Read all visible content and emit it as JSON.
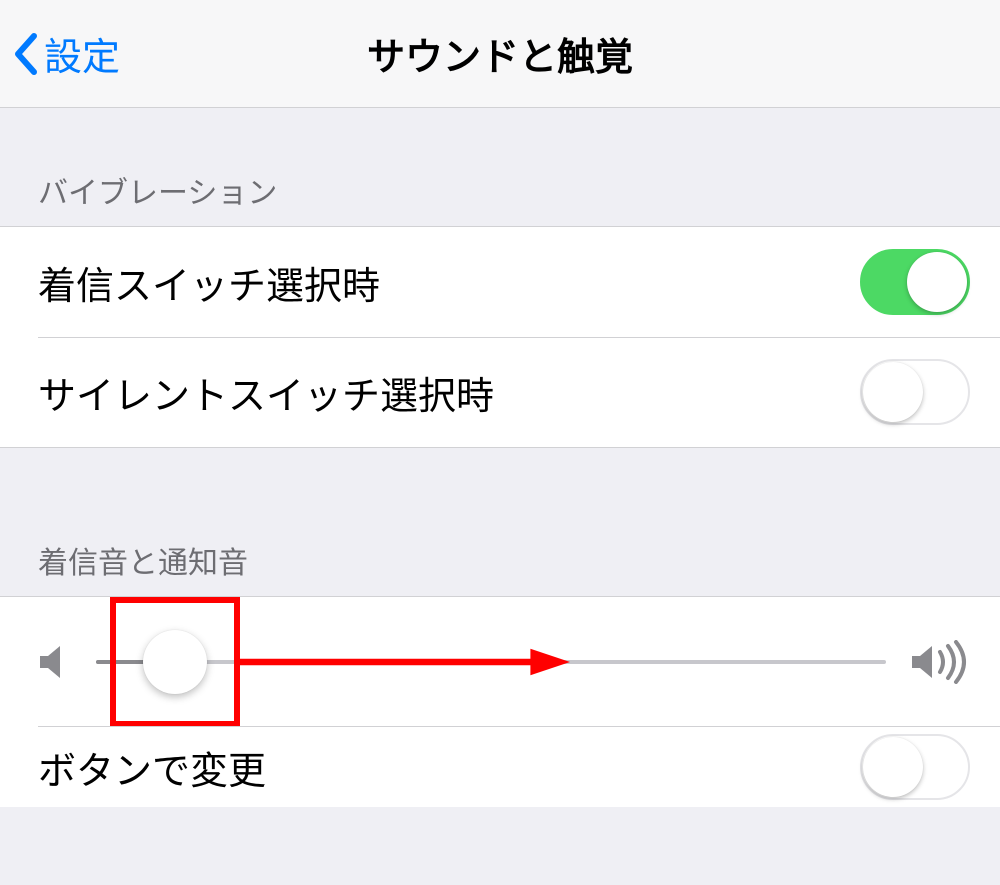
{
  "nav": {
    "back_label": "設定",
    "title": "サウンドと触覚"
  },
  "section_vibration": {
    "header": "バイブレーション",
    "row_ring": {
      "label": "着信スイッチ選択時",
      "on": true
    },
    "row_silent": {
      "label": "サイレントスイッチ選択時",
      "on": false
    }
  },
  "section_ringer": {
    "header": "着信音と通知音",
    "volume_percent": 10,
    "row_buttons": {
      "label": "ボタンで変更",
      "on": false
    }
  },
  "annotation": {
    "box_color": "#ff0000",
    "arrow_color": "#ff0000"
  }
}
